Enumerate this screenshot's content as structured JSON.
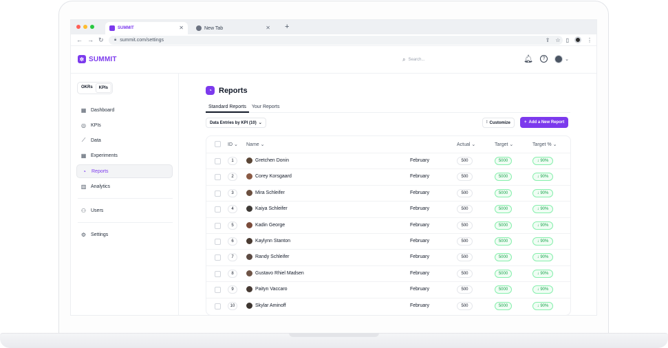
{
  "browser": {
    "tabs": [
      {
        "label": "SUMMIT",
        "active": true
      },
      {
        "label": "New Tab",
        "active": false
      }
    ],
    "new_tab_label": "+",
    "url": "summit.com/settings",
    "traffic_colors": [
      "#ff5f57",
      "#febc2e",
      "#28c840"
    ]
  },
  "header": {
    "logo_text": "SUMMIT",
    "search_placeholder": "Search..."
  },
  "sidebar": {
    "toggle": [
      "OKRs",
      "KPIs"
    ],
    "items": [
      {
        "label": "Dashboard",
        "icon": "grid-icon",
        "glyph": "▦"
      },
      {
        "label": "KPIs",
        "icon": "target-icon",
        "glyph": "◎"
      },
      {
        "label": "Data",
        "icon": "chart-line-icon",
        "glyph": "⟋"
      },
      {
        "label": "Experiments",
        "icon": "apps-icon",
        "glyph": "▦"
      },
      {
        "label": "Reports",
        "icon": "reports-icon",
        "glyph": "◔",
        "active": true
      },
      {
        "label": "Analytics",
        "icon": "bar-chart-icon",
        "glyph": "▥"
      },
      {
        "label": "Users",
        "icon": "users-icon",
        "glyph": "⚇"
      },
      {
        "label": "Settings",
        "icon": "gear-icon",
        "glyph": "⚙"
      }
    ]
  },
  "main": {
    "title": "Reports",
    "tabs": [
      "Standard Reports",
      "Your Reports"
    ],
    "filter_label": "Data Entries by KPI (10)",
    "customize_label": "Customize",
    "add_label": "Add a New Report",
    "columns": {
      "id": "ID",
      "name": "Name",
      "actual": "Actual",
      "target": "Target",
      "target_pct": "Target %"
    }
  },
  "rows": [
    {
      "id": "1",
      "name": "Gretchen Donin",
      "month": "February",
      "actual": "500",
      "target": "5000",
      "pct": "↓ 90%"
    },
    {
      "id": "2",
      "name": "Corey Korsgaard",
      "month": "February",
      "actual": "500",
      "target": "5000",
      "pct": "↓ 90%"
    },
    {
      "id": "3",
      "name": "Mira Schleifer",
      "month": "February",
      "actual": "500",
      "target": "5000",
      "pct": "↓ 90%"
    },
    {
      "id": "4",
      "name": "Kaiya Schleifer",
      "month": "February",
      "actual": "500",
      "target": "5000",
      "pct": "↓ 90%"
    },
    {
      "id": "5",
      "name": "Kadin George",
      "month": "February",
      "actual": "500",
      "target": "5000",
      "pct": "↓ 90%"
    },
    {
      "id": "6",
      "name": "Kaylynn Stanton",
      "month": "February",
      "actual": "500",
      "target": "5000",
      "pct": "↓ 90%"
    },
    {
      "id": "7",
      "name": "Randy Schleifer",
      "month": "February",
      "actual": "500",
      "target": "5000",
      "pct": "↓ 90%"
    },
    {
      "id": "8",
      "name": "Gustavo Rhiel Madsen",
      "month": "February",
      "actual": "500",
      "target": "5000",
      "pct": "↓ 90%"
    },
    {
      "id": "9",
      "name": "Paityn Vaccaro",
      "month": "February",
      "actual": "500",
      "target": "5000",
      "pct": "↓ 90%"
    },
    {
      "id": "10",
      "name": "Skylar Aminoff",
      "month": "February",
      "actual": "500",
      "target": "5000",
      "pct": "↓ 90%"
    }
  ],
  "colors": {
    "accent": "#7c3aed",
    "success": "#16a34a"
  }
}
